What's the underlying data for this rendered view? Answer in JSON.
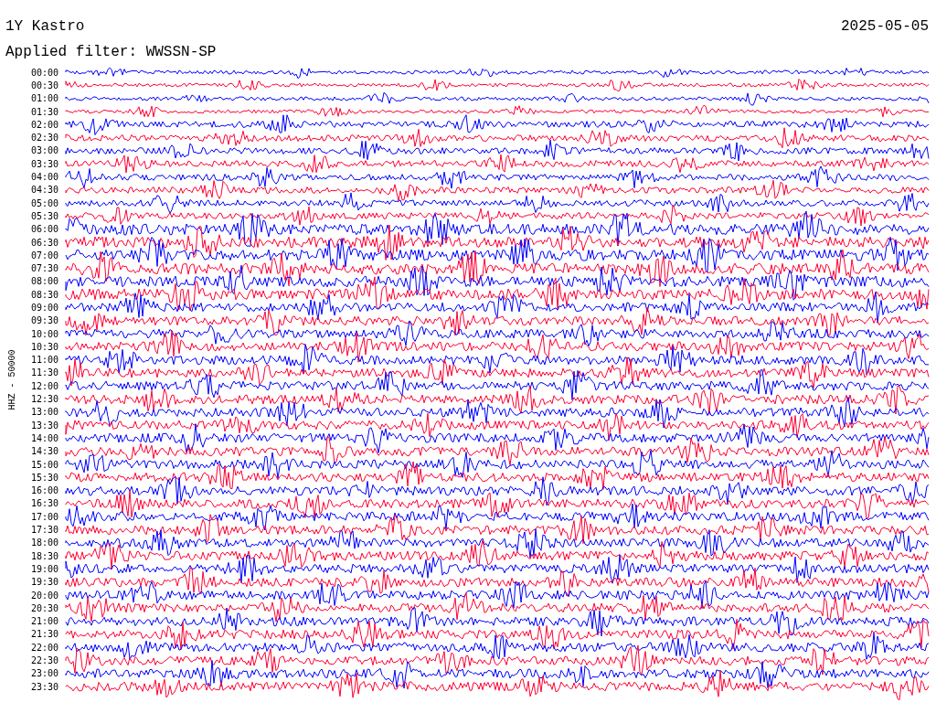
{
  "station": "1Y Kastro",
  "date": "2025-05-05",
  "filter": "Applied filter: WWSSN-SP",
  "axis_label": "HHZ - 50000",
  "rows": [
    {
      "time": "00:00",
      "color": "#0000ff"
    },
    {
      "time": "00:30",
      "color": "#ff0033"
    },
    {
      "time": "01:00",
      "color": "#0000ff"
    },
    {
      "time": "01:30",
      "color": "#ff0033"
    },
    {
      "time": "02:00",
      "color": "#0000ff"
    },
    {
      "time": "02:30",
      "color": "#ff0033"
    },
    {
      "time": "03:00",
      "color": "#0000ff"
    },
    {
      "time": "03:30",
      "color": "#ff0033"
    },
    {
      "time": "04:00",
      "color": "#0000ff"
    },
    {
      "time": "04:30",
      "color": "#ff0033"
    },
    {
      "time": "05:00",
      "color": "#0000ff"
    },
    {
      "time": "05:30",
      "color": "#ff0033"
    },
    {
      "time": "06:00",
      "color": "#0000ff"
    },
    {
      "time": "06:30",
      "color": "#ff0033"
    },
    {
      "time": "07:00",
      "color": "#0000ff"
    },
    {
      "time": "07:30",
      "color": "#ff0033"
    },
    {
      "time": "08:00",
      "color": "#0000ff"
    },
    {
      "time": "08:30",
      "color": "#ff0033"
    },
    {
      "time": "09:00",
      "color": "#0000ff"
    },
    {
      "time": "09:30",
      "color": "#ff0033"
    },
    {
      "time": "10:00",
      "color": "#0000ff"
    },
    {
      "time": "10:30",
      "color": "#ff0033"
    },
    {
      "time": "11:00",
      "color": "#0000ff"
    },
    {
      "time": "11:30",
      "color": "#ff0033"
    },
    {
      "time": "12:00",
      "color": "#0000ff"
    },
    {
      "time": "12:30",
      "color": "#ff0033"
    },
    {
      "time": "13:00",
      "color": "#0000ff"
    },
    {
      "time": "13:30",
      "color": "#ff0033"
    },
    {
      "time": "14:00",
      "color": "#0000ff"
    },
    {
      "time": "14:30",
      "color": "#ff0033"
    },
    {
      "time": "15:00",
      "color": "#0000ff"
    },
    {
      "time": "15:30",
      "color": "#ff0033"
    },
    {
      "time": "16:00",
      "color": "#0000ff"
    },
    {
      "time": "16:30",
      "color": "#ff0033"
    },
    {
      "time": "17:00",
      "color": "#0000ff"
    },
    {
      "time": "17:30",
      "color": "#ff0033"
    },
    {
      "time": "18:00",
      "color": "#0000ff"
    },
    {
      "time": "18:30",
      "color": "#ff0033"
    },
    {
      "time": "19:00",
      "color": "#0000ff"
    },
    {
      "time": "19:30",
      "color": "#ff0033"
    },
    {
      "time": "20:00",
      "color": "#0000ff"
    },
    {
      "time": "20:30",
      "color": "#ff0033"
    },
    {
      "time": "21:00",
      "color": "#0000ff"
    },
    {
      "time": "21:30",
      "color": "#ff0033"
    },
    {
      "time": "22:00",
      "color": "#0000ff"
    },
    {
      "time": "22:30",
      "color": "#ff0033"
    },
    {
      "time": "23:00",
      "color": "#0000ff"
    },
    {
      "time": "23:30",
      "color": "#ff0033"
    }
  ]
}
